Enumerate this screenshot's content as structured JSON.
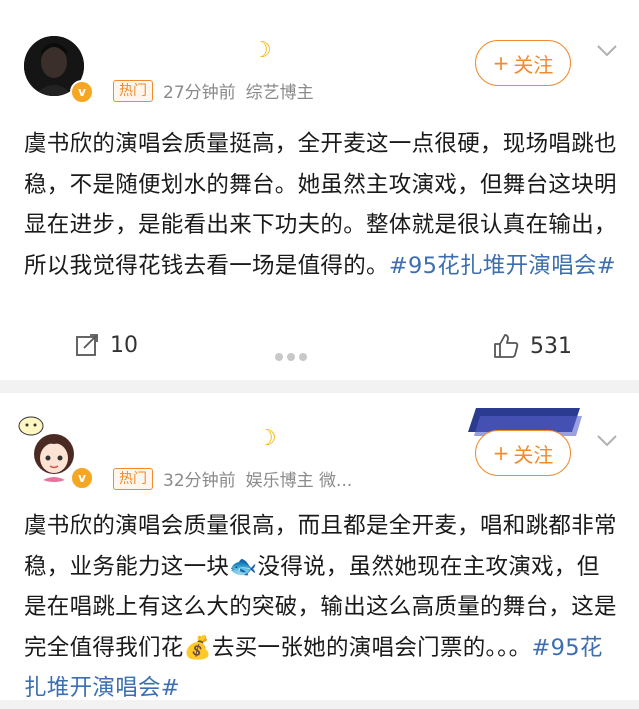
{
  "post1": {
    "tag": "热门",
    "time": "27分钟前",
    "user_type": "综艺博主",
    "follow_label": "关注",
    "body": "虞书欣的演唱会质量挺高，全开麦这一点很硬，现场唱跳也稳，不是随便划水的舞台。她虽然主攻演戏，但舞台这块明显在进步，是能看出来下功夫的。整体就是很认真在输出，所以我觉得花钱去看一场是值得的。",
    "hashtag": "#95花扎堆开演唱会#",
    "repost_count": "10",
    "like_count": "531"
  },
  "post2": {
    "tag": "热门",
    "time": "32分钟前",
    "user_type": "娱乐博主 微...",
    "follow_label": "关注",
    "body_part1": "虞书欣的演唱会质量很高，而且都是全开麦，唱和跳都非常稳，业务能力这一块",
    "body_part2": "没得说，虽然她现在主攻演戏，但是在唱跳上有这么大的突破，输出这么高质量的舞台，这是完全值得我们花",
    "body_part3": "去买一张她的演唱会门票的。。。",
    "hashtag": "#95花扎堆开演唱会#"
  },
  "colors": {
    "accent": "#f08b2e",
    "hashtag": "#3d6fb0",
    "meta": "#8a8a8a",
    "badge": "#f5a623"
  }
}
